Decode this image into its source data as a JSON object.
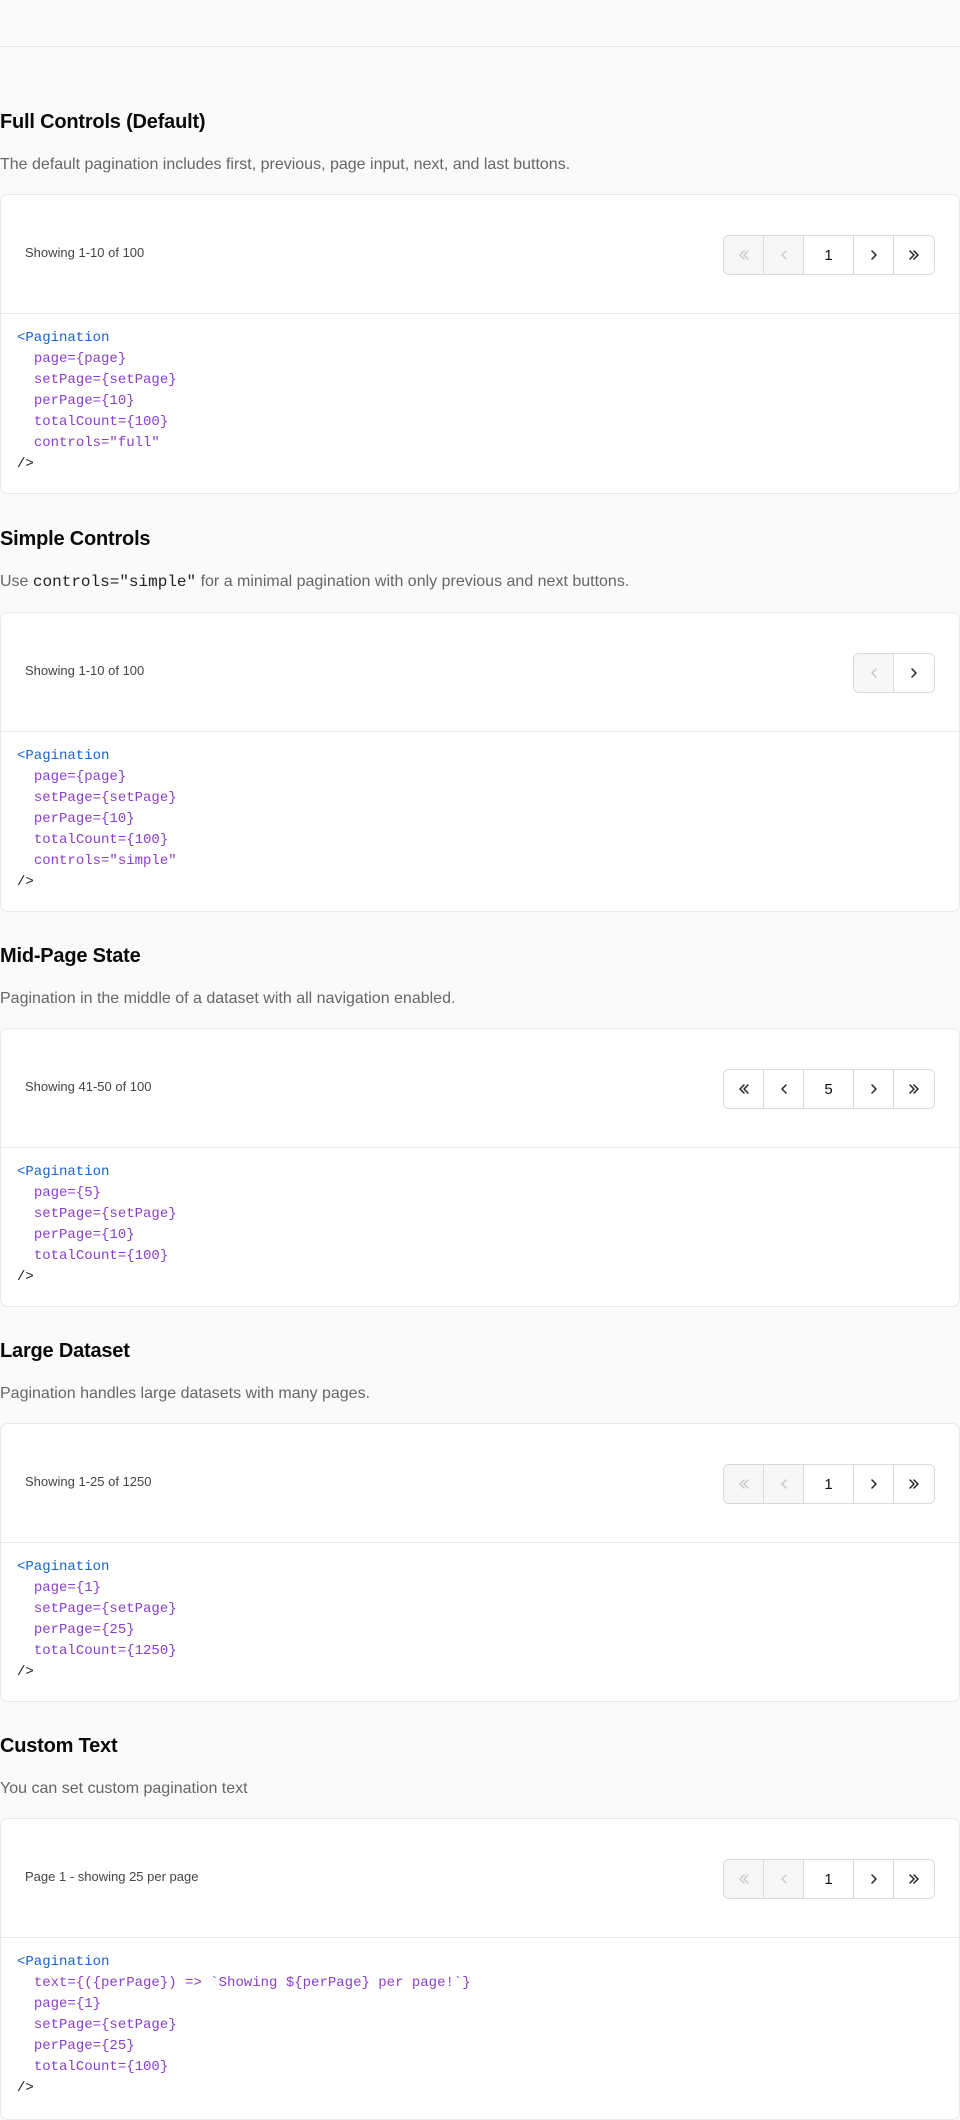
{
  "sections": [
    {
      "title": "Full Controls (Default)",
      "description": "The default pagination includes first, previous, page input, next, and last buttons.",
      "showing": "Showing 1-10 of 100",
      "controls": "full",
      "page_value": "1",
      "first_disabled": true,
      "prev_disabled": true,
      "code_lines": [
        "<Pagination",
        "page={page}",
        "setPage={setPage}",
        "perPage={10}",
        "totalCount={100}",
        "controls=\"full\"",
        "/>"
      ]
    },
    {
      "title": "Simple Controls",
      "description_prefix": "Use ",
      "description_code": "controls=\"simple\"",
      "description_suffix": " for a minimal pagination with only previous and next buttons.",
      "showing": "Showing 1-10 of 100",
      "controls": "simple",
      "prev_disabled": true,
      "code_lines": [
        "<Pagination",
        "page={page}",
        "setPage={setPage}",
        "perPage={10}",
        "totalCount={100}",
        "controls=\"simple\"",
        "/>"
      ]
    },
    {
      "title": "Mid-Page State",
      "description": "Pagination in the middle of a dataset with all navigation enabled.",
      "showing": "Showing 41-50 of 100",
      "controls": "full",
      "page_value": "5",
      "first_disabled": false,
      "prev_disabled": false,
      "code_lines": [
        "<Pagination",
        "page={5}",
        "setPage={setPage}",
        "perPage={10}",
        "totalCount={100}",
        "/>"
      ]
    },
    {
      "title": "Large Dataset",
      "description": "Pagination handles large datasets with many pages.",
      "showing": "Showing 1-25 of 1250",
      "controls": "full",
      "page_value": "1",
      "first_disabled": true,
      "prev_disabled": true,
      "code_lines": [
        "<Pagination",
        "page={1}",
        "setPage={setPage}",
        "perPage={25}",
        "totalCount={1250}",
        "/>"
      ]
    },
    {
      "title": "Custom Text",
      "description": "You can set custom pagination text",
      "showing": "Page 1 - showing 25 per page",
      "controls": "full",
      "page_value": "1",
      "first_disabled": true,
      "prev_disabled": true,
      "code_lines": [
        "<Pagination",
        "text={({perPage}) => `Showing ${perPage} per page!`}",
        "page={1}",
        "setPage={setPage}",
        "perPage={25}",
        "totalCount={100}",
        "/>"
      ]
    }
  ],
  "icons": {
    "first": "chevrons-left-icon",
    "prev": "chevron-left-icon",
    "next": "chevron-right-icon",
    "last": "chevrons-right-icon"
  },
  "colors": {
    "tag": "#1763c9",
    "attr": "#8a3fc7",
    "equals": "#d3266b",
    "string": "#0b2a5e",
    "param": "#e36209"
  }
}
